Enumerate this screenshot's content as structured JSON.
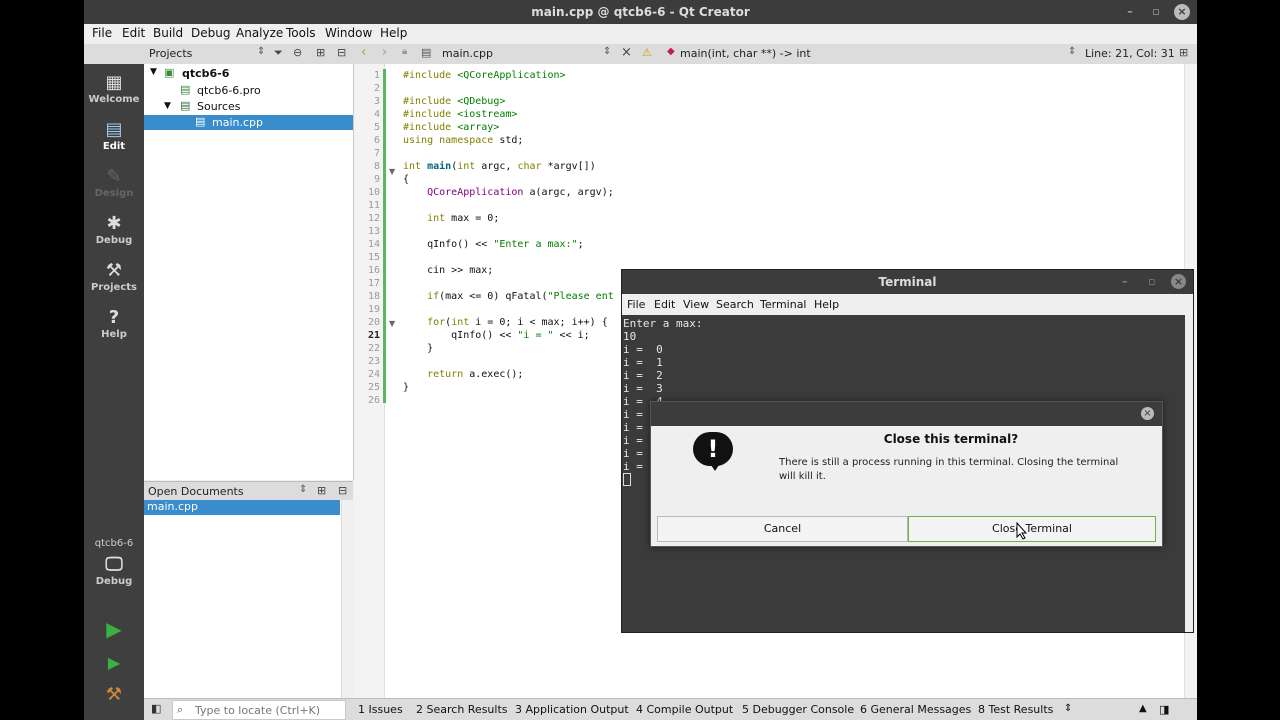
{
  "window": {
    "title": "main.cpp @ qtcb6-6 - Qt Creator"
  },
  "menubar": [
    "File",
    "Edit",
    "Build",
    "Debug",
    "Analyze",
    "Tools",
    "Window",
    "Help"
  ],
  "toolbar": {
    "panel_title": "Projects",
    "file_name": "main.cpp",
    "function_sig": "main(int, char **) -> int",
    "position": "Line: 21, Col: 31"
  },
  "modes": [
    {
      "label": "Welcome",
      "icon": "grid-icon"
    },
    {
      "label": "Edit",
      "icon": "document-icon"
    },
    {
      "label": "Design",
      "icon": "pencil-icon"
    },
    {
      "label": "Debug",
      "icon": "bug-icon"
    },
    {
      "label": "Projects",
      "icon": "wrench-icon"
    },
    {
      "label": "Help",
      "icon": "help-icon"
    }
  ],
  "target": {
    "project": "qtcb6-6",
    "config": "Debug"
  },
  "projects_tree": {
    "root": "qtcb6-6",
    "pro_file": "qtcb6-6.pro",
    "sources": "Sources",
    "main": "main.cpp"
  },
  "open_documents": {
    "title": "Open Documents",
    "items": [
      "main.cpp"
    ]
  },
  "editor": {
    "line_numbers": [
      "1",
      "2",
      "3",
      "4",
      "5",
      "6",
      "7",
      "8",
      "9",
      "10",
      "11",
      "12",
      "13",
      "14",
      "15",
      "16",
      "17",
      "18",
      "19",
      "20",
      "21",
      "22",
      "23",
      "24",
      "25",
      "26"
    ],
    "current_line": "21",
    "lines": [
      "#include <QCoreApplication>",
      "",
      "#include <QDebug>",
      "#include <iostream>",
      "#include <array>",
      "using namespace std;",
      "",
      "int main(int argc, char *argv[])",
      "{",
      "    QCoreApplication a(argc, argv);",
      "",
      "    int max = 0;",
      "",
      "    qInfo() << \"Enter a max:\";",
      "",
      "    cin >> max;",
      "",
      "    if(max <= 0) qFatal(\"Please ent",
      "",
      "    for(int i = 0; i < max; i++) {",
      "        qInfo() << \"i = \" << i;",
      "    }",
      "",
      "    return a.exec();",
      "}",
      ""
    ]
  },
  "statusbar": {
    "locate_placeholder": "Type to locate (Ctrl+K)",
    "panes": [
      "1  Issues",
      "2  Search Results",
      "3  Application Output",
      "4  Compile Output",
      "5  Debugger Console",
      "6  General Messages",
      "8  Test Results"
    ]
  },
  "terminal": {
    "title": "Terminal",
    "menu": [
      "File",
      "Edit",
      "View",
      "Search",
      "Terminal",
      "Help"
    ],
    "output": [
      "Enter a max:",
      "10",
      "i =  0",
      "i =  1",
      "i =  2",
      "i =  3",
      "i =  4",
      "i = ",
      "i = ",
      "i = ",
      "i = ",
      "i = "
    ]
  },
  "dialog": {
    "title": "Close this terminal?",
    "message": "There is still a process running in this terminal. Closing the terminal will kill it.",
    "cancel": "Cancel",
    "confirm": "Close Terminal"
  }
}
